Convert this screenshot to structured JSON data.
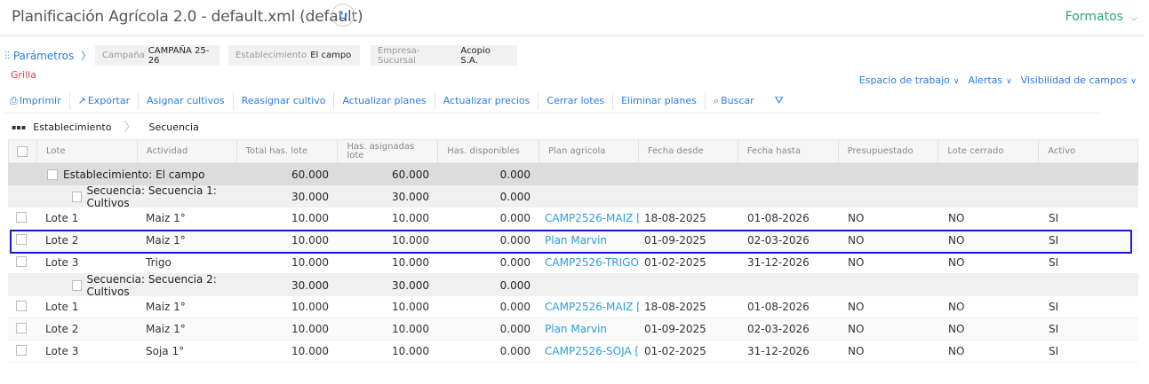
{
  "header": {
    "title": "Planificación Agrícola 2.0 - default.xml (default)",
    "formatos_label": "Formatos"
  },
  "params": {
    "link_label": "Parámetros",
    "campana": {
      "label": "Campaña",
      "value": "CAMPAÑA 25-26"
    },
    "establecimiento": {
      "label": "Establecimiento",
      "value": "El campo"
    },
    "empresa": {
      "label": "Empresa-Sucursal",
      "value": "Acopio S.A."
    },
    "grilla_label": "Grilla"
  },
  "right_menu": {
    "espacio": "Espacio de trabajo",
    "alertas": "Alertas",
    "visibilidad": "Visibilidad de campos"
  },
  "toolbar": {
    "imprimir": "Imprimir",
    "exportar": "Exportar",
    "asignar": "Asignar cultivos",
    "reasignar": "Reasignar cultivo",
    "actualizar_planes": "Actualizar planes",
    "actualizar_precios": "Actualizar precios",
    "cerrar_lotes": "Cerrar lotes",
    "eliminar_planes": "Eliminar planes",
    "buscar": "Buscar"
  },
  "breadcrumb": {
    "level1": "Establecimiento",
    "level2": "Secuencia"
  },
  "grid": {
    "columns": {
      "lote": "Lote",
      "actividad": "Actividad",
      "total": "Total has. lote",
      "asignadas_1": "Has. asignadas",
      "asignadas_2": "lote",
      "disponibles": "Has. disponibles",
      "plan": "Plan agricola",
      "fecha_desde": "Fecha desde",
      "fecha_hasta": "Fecha hasta",
      "presupuestado": "Presupuestado",
      "lote_cerrado": "Lote cerrado",
      "activo": "Activo"
    },
    "group_establecimiento": {
      "label": "Establecimiento: El campo",
      "total": "60.000",
      "asignadas": "60.000",
      "disponibles": "0.000"
    },
    "secuencia1": {
      "label": "Secuencia: Secuencia 1: Cultivos",
      "total": "30.000",
      "asignadas": "30.000",
      "disponibles": "0.000"
    },
    "secuencia2": {
      "label": "Secuencia: Secuencia 2: Cultivos",
      "total": "30.000",
      "asignadas": "30.000",
      "disponibles": "0.000"
    },
    "rows1": [
      {
        "lote": "Lote 1",
        "actividad": "Maiz 1°",
        "total": "10.000",
        "asignadas": "10.000",
        "disponibles": "0.000",
        "plan": "CAMP2526-MAIZ [",
        "fecha_desde": "18-08-2025",
        "fecha_hasta": "01-08-2026",
        "presupuestado": "NO",
        "lote_cerrado": "NO",
        "activo": "SI"
      },
      {
        "lote": "Lote 2",
        "actividad": "Maiz 1°",
        "total": "10.000",
        "asignadas": "10.000",
        "disponibles": "0.000",
        "plan": "Plan Marvin",
        "fecha_desde": "01-09-2025",
        "fecha_hasta": "02-03-2026",
        "presupuestado": "NO",
        "lote_cerrado": "NO",
        "activo": "SI"
      },
      {
        "lote": "Lote 3",
        "actividad": "Trigo",
        "total": "10.000",
        "asignadas": "10.000",
        "disponibles": "0.000",
        "plan": "CAMP2526-TRIGO",
        "fecha_desde": "01-02-2025",
        "fecha_hasta": "31-12-2026",
        "presupuestado": "NO",
        "lote_cerrado": "NO",
        "activo": "SI"
      }
    ],
    "rows2": [
      {
        "lote": "Lote 1",
        "actividad": "Maiz 1°",
        "total": "10.000",
        "asignadas": "10.000",
        "disponibles": "0.000",
        "plan": "CAMP2526-MAIZ [",
        "fecha_desde": "18-08-2025",
        "fecha_hasta": "01-08-2026",
        "presupuestado": "NO",
        "lote_cerrado": "NO",
        "activo": "SI"
      },
      {
        "lote": "Lote 2",
        "actividad": "Maiz 1°",
        "total": "10.000",
        "asignadas": "10.000",
        "disponibles": "0.000",
        "plan": "Plan Marvin",
        "fecha_desde": "01-09-2025",
        "fecha_hasta": "02-03-2026",
        "presupuestado": "NO",
        "lote_cerrado": "NO",
        "activo": "SI"
      },
      {
        "lote": "Lote 3",
        "actividad": "Soja 1°",
        "total": "10.000",
        "asignadas": "10.000",
        "disponibles": "0.000",
        "plan": "CAMP2526-SOJA [",
        "fecha_desde": "01-02-2025",
        "fecha_hasta": "31-12-2026",
        "presupuestado": "NO",
        "lote_cerrado": "NO",
        "activo": "SI"
      }
    ]
  },
  "colors": {
    "accent": "#2a7be4",
    "link": "#2a9fd6",
    "formatos": "#2aa772",
    "grilla": "#e04545",
    "highlight_border": "#1a1ad6"
  }
}
